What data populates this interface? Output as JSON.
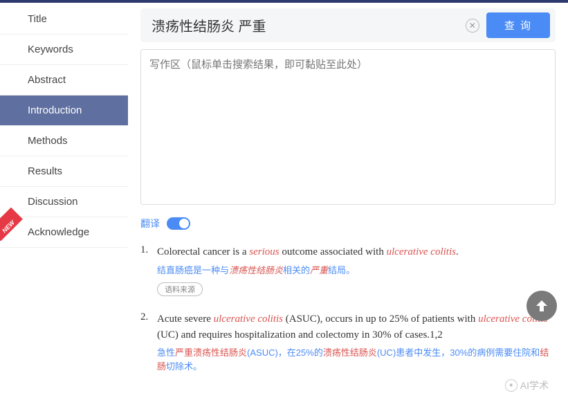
{
  "sidebar": {
    "items": [
      {
        "label": "Title"
      },
      {
        "label": "Keywords"
      },
      {
        "label": "Abstract"
      },
      {
        "label": "Introduction"
      },
      {
        "label": "Methods"
      },
      {
        "label": "Results"
      },
      {
        "label": "Discussion"
      },
      {
        "label": "Acknowledge"
      }
    ],
    "new_badge": "NEW"
  },
  "search": {
    "value": "溃疡性结肠炎 严重",
    "query_button": "查 询"
  },
  "writing_area": {
    "placeholder": "写作区（鼠标单击搜索结果，即可黏贴至此处）"
  },
  "translate": {
    "label": "翻译",
    "enabled": true
  },
  "results": [
    {
      "num": "1.",
      "en_parts": [
        {
          "t": "Colorectal cancer is a "
        },
        {
          "t": "serious",
          "cls": "hl-red"
        },
        {
          "t": " outcome associated with "
        },
        {
          "t": "ulcerative colitis",
          "cls": "hl-red"
        },
        {
          "t": "."
        }
      ],
      "zh_parts": [
        {
          "t": "结直肠癌是一种与"
        },
        {
          "t": "溃疡性结肠炎",
          "cls": "hl-red"
        },
        {
          "t": "相关的"
        },
        {
          "t": "严重",
          "cls": "hl-red"
        },
        {
          "t": "结局。"
        }
      ],
      "source_btn": "语料来源"
    },
    {
      "num": "2.",
      "en_parts": [
        {
          "t": "Acute severe "
        },
        {
          "t": "ulcerative colitis",
          "cls": "hl-red"
        },
        {
          "t": " (ASUC), occurs in up to 25% of patients with "
        },
        {
          "t": "ulcerative colitis",
          "cls": "hl-red"
        },
        {
          "t": " (UC) and requires hospitalization and colectomy in 30% of cases.1,2"
        }
      ],
      "zh_parts": [
        {
          "t": "急性"
        },
        {
          "t": "严重溃疡性结肠炎",
          "cls": "hl-red-n"
        },
        {
          "t": "(ASUC)，在25%的"
        },
        {
          "t": "溃疡性结肠炎",
          "cls": "hl-red-n"
        },
        {
          "t": "(UC)患者中发生，30%的病例需要住院和"
        },
        {
          "t": "结肠",
          "cls": "hl-red-n"
        },
        {
          "t": "切除术。"
        }
      ]
    }
  ],
  "watermark": "AI学术"
}
